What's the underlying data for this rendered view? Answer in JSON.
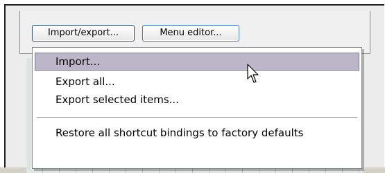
{
  "buttons": {
    "import_export": "Import/export...",
    "menu_editor": "Menu editor..."
  },
  "menu": {
    "items": [
      {
        "label": "Import..."
      },
      {
        "label": "Export all..."
      },
      {
        "label": "Export selected items..."
      },
      {
        "label": "Restore all shortcut bindings to factory defaults"
      }
    ],
    "highlight_color": "#bcb6c8"
  },
  "cursor": {
    "icon": "mouse-pointer-icon"
  }
}
